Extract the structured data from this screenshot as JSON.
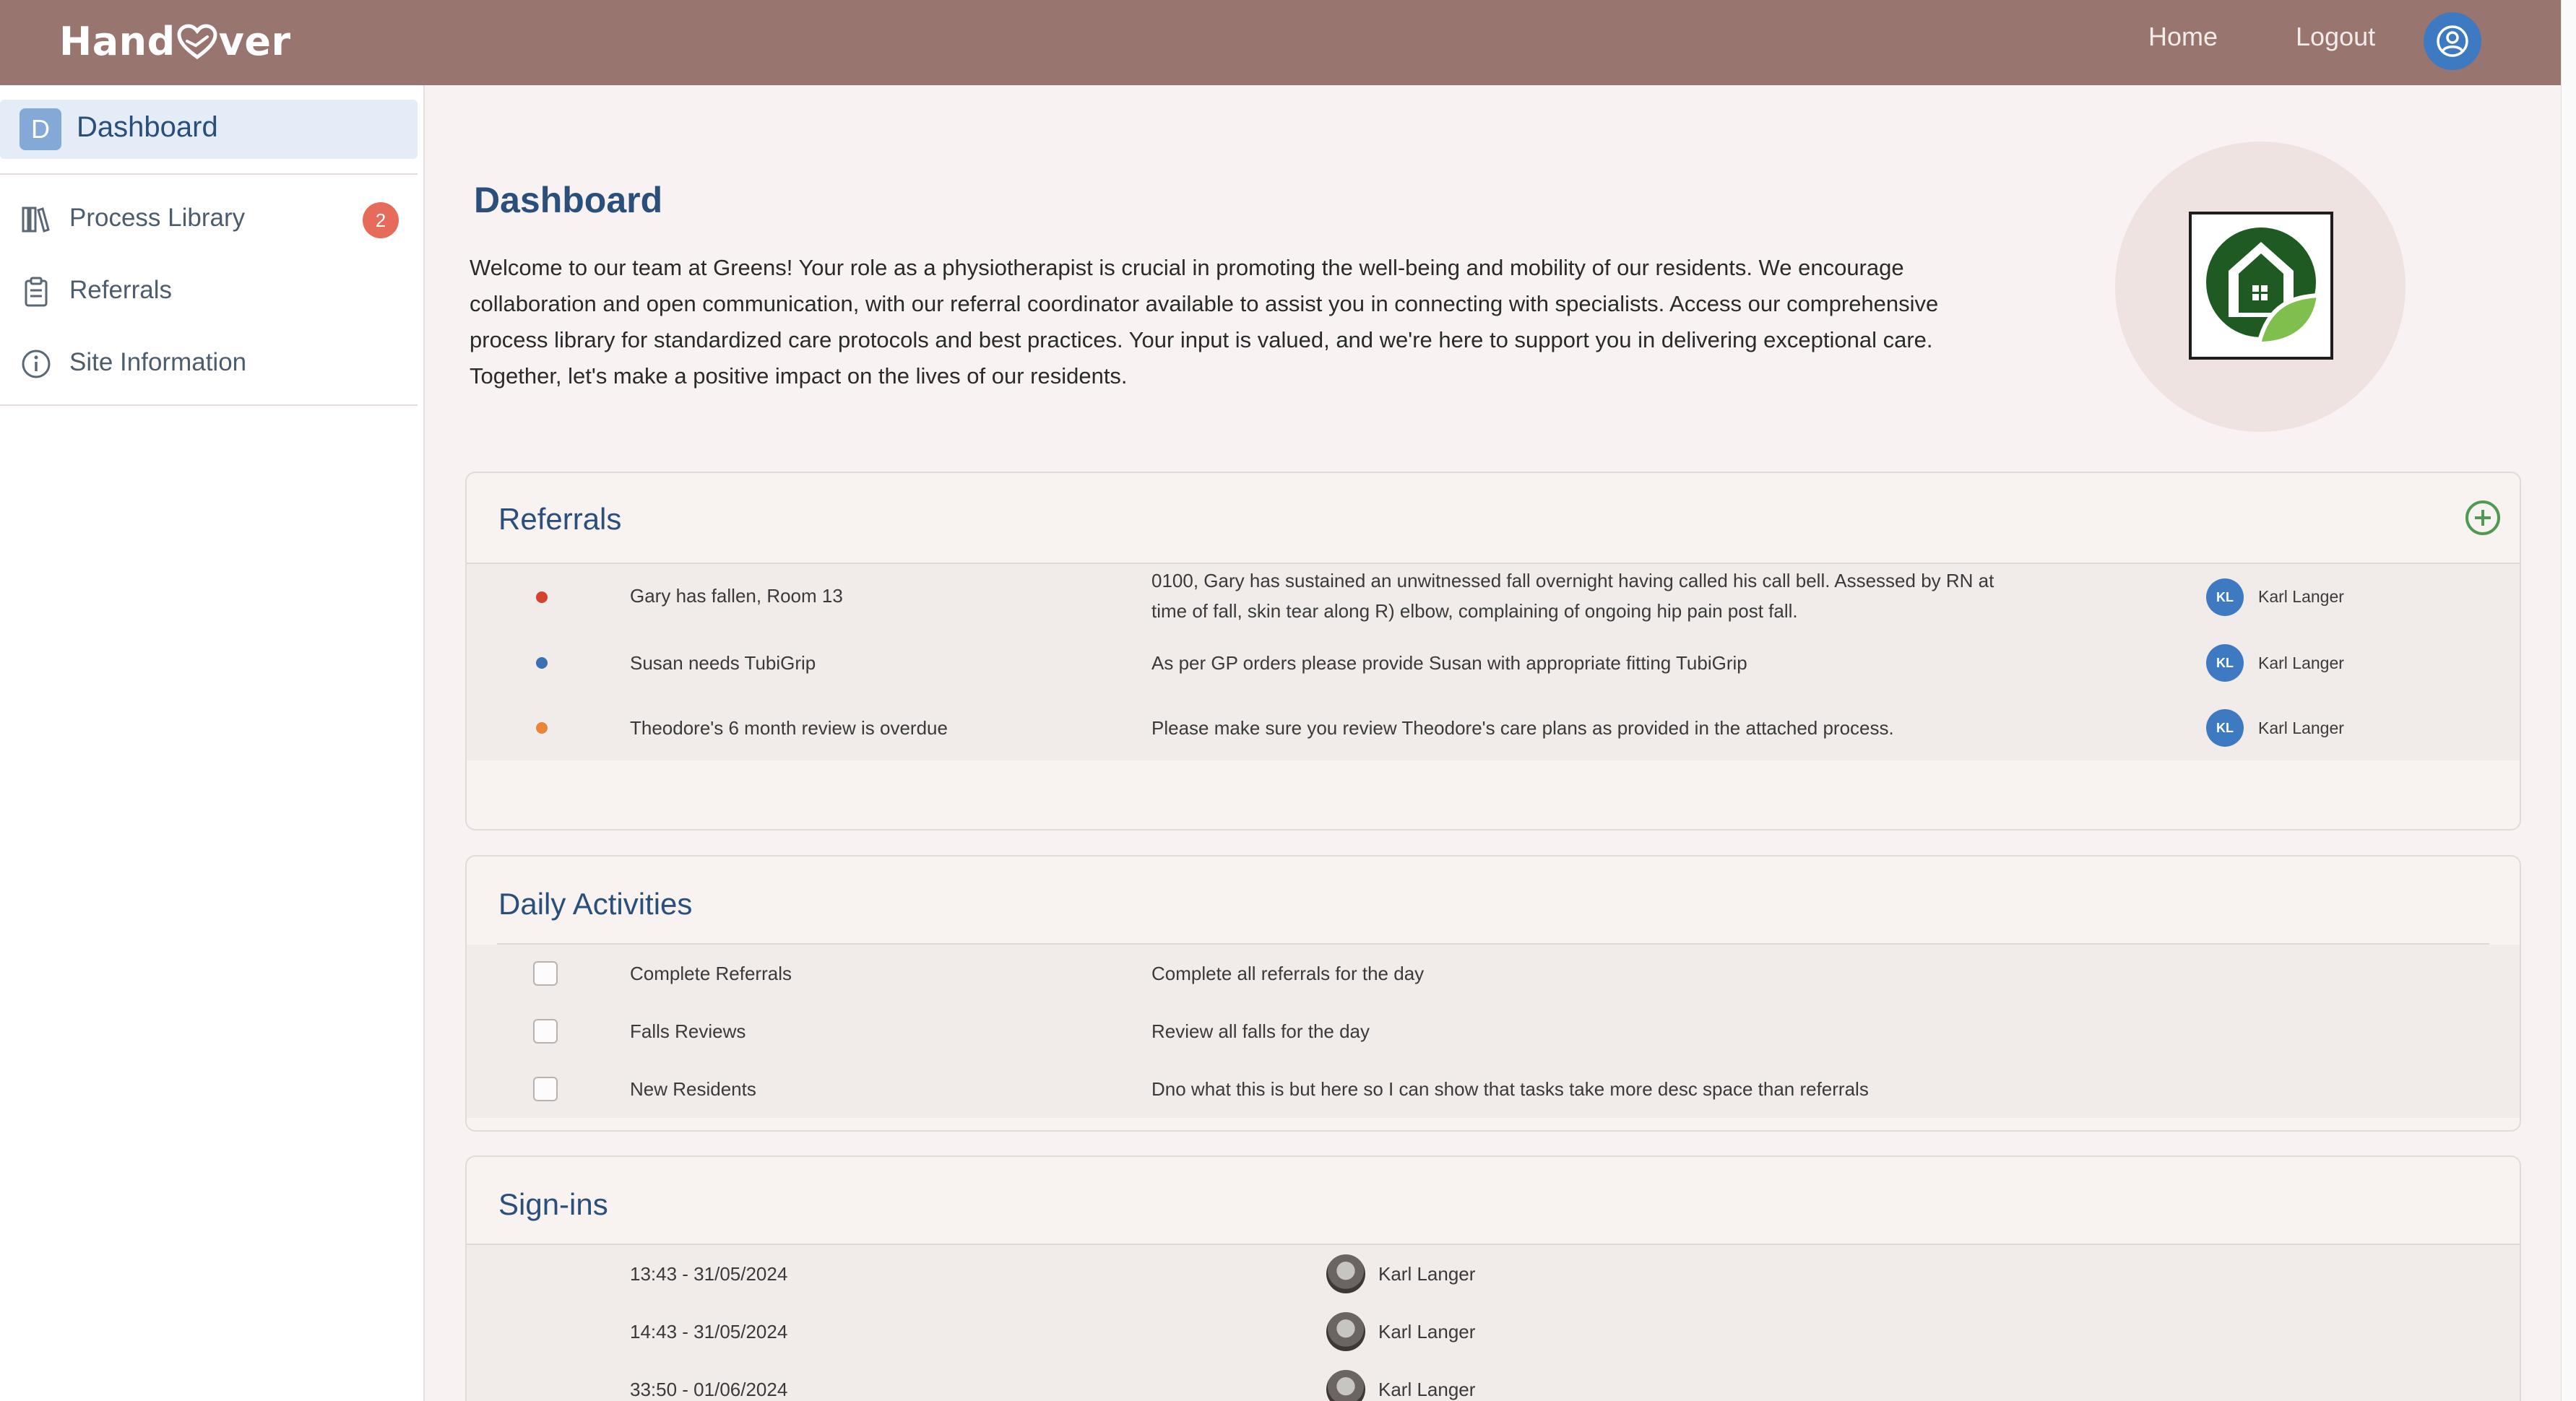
{
  "app": {
    "brand": "Hand ver",
    "brand_parts": [
      "Hand",
      "ver"
    ]
  },
  "topbar": {
    "home_label": "Home",
    "logout_label": "Logout",
    "user_icon": "user-circle-icon",
    "background": "#98756f"
  },
  "sidebar": {
    "dashboard": {
      "letter": "D",
      "label": "Dashboard"
    },
    "items": [
      {
        "label": "Process Library",
        "icon": "books-icon",
        "badge": "2"
      },
      {
        "label": "Referrals",
        "icon": "clipboard-icon"
      },
      {
        "label": "Site Information",
        "icon": "info-icon"
      }
    ]
  },
  "main": {
    "title": "Dashboard",
    "welcome": "Welcome to our team at Greens! Your role as a physiotherapist is crucial in promoting the well-being and mobility of our residents. We encourage collaboration and open communication, with our referral coordinator available to assist you in connecting with specialists. Access our comprehensive process library for standardized care protocols and best practices. Your input is valued, and we're here to support you in delivering exceptional care. Together, let's make a positive impact on the lives of our residents.",
    "site_logo_icon": "house-leaf-logo"
  },
  "referrals": {
    "title": "Referrals",
    "add_icon": "plus-circle-icon",
    "rows": [
      {
        "priority": "red",
        "color": "#d8412f",
        "title": "Gary has fallen, Room 13",
        "desc_line1": "0100, Gary has sustained an unwitnessed fall overnight having called his call bell. Assessed by RN at",
        "desc_line2": "time of fall, skin tear along R) elbow, complaining of ongoing hip pain post fall.",
        "assignee_initials": "KL",
        "assignee": "Karl Langer"
      },
      {
        "priority": "blue",
        "color": "#3d6fb5",
        "title": "Susan needs TubiGrip",
        "desc_line1": "As per GP orders please provide Susan with appropriate fitting TubiGrip",
        "desc_line2": "",
        "assignee_initials": "KL",
        "assignee": "Karl Langer"
      },
      {
        "priority": "orange",
        "color": "#e8843b",
        "title": "Theodore's 6 month review is overdue",
        "desc_line1": "Please make sure you review Theodore's care plans as provided in the attached process.",
        "desc_line2": "",
        "assignee_initials": "KL",
        "assignee": "Karl Langer"
      }
    ]
  },
  "daily_activities": {
    "title": "Daily Activities",
    "rows": [
      {
        "title": "Complete Referrals",
        "desc": "Complete all referrals for the day",
        "checked": false
      },
      {
        "title": "Falls Reviews",
        "desc": "Review all falls for the day",
        "checked": false
      },
      {
        "title": "New Residents",
        "desc": "Dno what this is but here so I can show that tasks take more desc space than referrals",
        "checked": false
      }
    ]
  },
  "sign_ins": {
    "title": "Sign-ins",
    "rows": [
      {
        "time": "13:43 - 31/05/2024",
        "name": "Karl Langer",
        "avatar": "cat-avatar"
      },
      {
        "time": "14:43 - 31/05/2024",
        "name": "Karl Langer",
        "avatar": "cat-avatar"
      },
      {
        "time": "33:50 - 01/06/2024",
        "name": "Karl Langer",
        "avatar": "cat-avatar"
      }
    ]
  }
}
